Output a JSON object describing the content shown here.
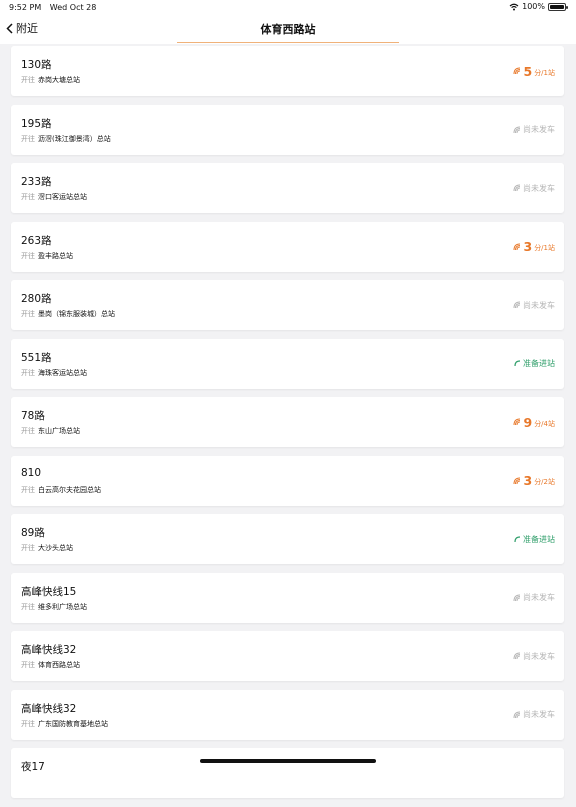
{
  "status_bar": {
    "time": "9:52 PM",
    "date": "Wed Oct 28",
    "battery": "100%"
  },
  "nav": {
    "back_label": "附近",
    "title": "体育西路站"
  },
  "labels": {
    "dest_prefix": "开往",
    "dest_suffix": "总站"
  },
  "colors": {
    "eta": "#e8782a",
    "arriving": "#2f9e6a",
    "waiting": "#b5b5b5"
  },
  "routes": [
    {
      "name": "130路",
      "destination": "赤岗大塘总站",
      "status_type": "eta",
      "eta_value": "5",
      "eta_unit": "分/1站"
    },
    {
      "name": "195路",
      "destination": "沥滘(珠江御景湾）总站",
      "status_type": "waiting",
      "status_text": "尚未发车"
    },
    {
      "name": "233路",
      "destination": "滘口客运站总站",
      "status_type": "waiting",
      "status_text": "尚未发车"
    },
    {
      "name": "263路",
      "destination": "盈丰路总站",
      "status_type": "eta",
      "eta_value": "3",
      "eta_unit": "分/1站"
    },
    {
      "name": "280路",
      "destination": "墨岗（锦东服装城）总站",
      "status_type": "waiting",
      "status_text": "尚未发车"
    },
    {
      "name": "551路",
      "destination": "海珠客运站总站",
      "status_type": "arriving",
      "status_text": "准备进站"
    },
    {
      "name": "78路",
      "destination": "东山广场总站",
      "status_type": "eta",
      "eta_value": "9",
      "eta_unit": "分/4站"
    },
    {
      "name": "810",
      "destination": "白云高尔夫花园总站",
      "status_type": "eta",
      "eta_value": "3",
      "eta_unit": "分/2站"
    },
    {
      "name": "89路",
      "destination": "大沙头总站",
      "status_type": "arriving",
      "status_text": "准备进站"
    },
    {
      "name": "高峰快线15",
      "destination": "维多利广场总站",
      "status_type": "waiting",
      "status_text": "尚未发车"
    },
    {
      "name": "高峰快线32",
      "destination": "体育西路总站",
      "status_type": "waiting",
      "status_text": "尚未发车"
    },
    {
      "name": "高峰快线32",
      "destination": "广东国防教育基地总站",
      "status_type": "waiting",
      "status_text": "尚未发车"
    },
    {
      "name": "夜17",
      "destination": "",
      "status_type": "none"
    }
  ]
}
